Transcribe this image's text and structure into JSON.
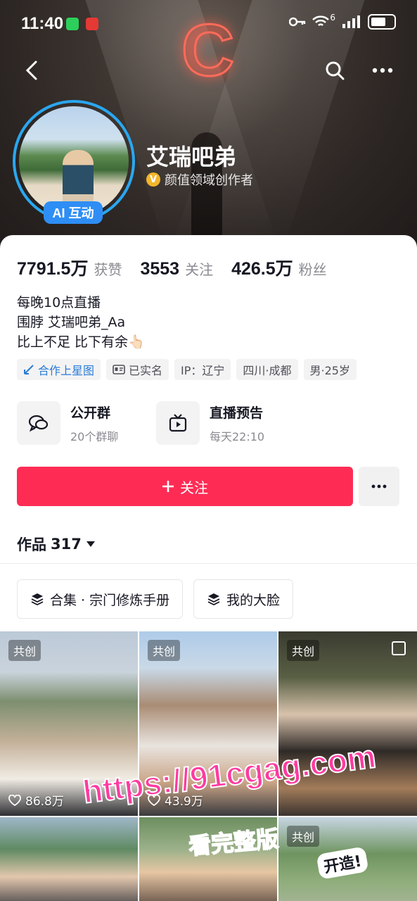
{
  "status_bar": {
    "time": "11:40",
    "network": "6"
  },
  "profile": {
    "nickname": "艾瑞吧弟",
    "verification": "颜值领域创作者",
    "ai_badge": "AI 互动",
    "neon_sign": "C"
  },
  "stats": [
    {
      "value": "7791.5万",
      "label": "获赞"
    },
    {
      "value": "3553",
      "label": "关注"
    },
    {
      "value": "426.5万",
      "label": "粉丝"
    }
  ],
  "bio": [
    "每晚10点直播",
    "围脖 艾瑞吧弟_Aa",
    "比上不足 比下有余👆🏻"
  ],
  "tags": [
    {
      "label": "合作上星图",
      "icon": "star-chart-icon"
    },
    {
      "label": "已实名",
      "icon": "id-card-icon"
    },
    {
      "label": "IP：辽宁"
    },
    {
      "label": "四川·成都"
    },
    {
      "label": "男·25岁"
    }
  ],
  "quick_actions": [
    {
      "title": "公开群",
      "subtitle": "20个群聊",
      "icon": "chat-bubbles-icon"
    },
    {
      "title": "直播预告",
      "subtitle": "每天22:10",
      "icon": "tv-icon"
    }
  ],
  "follow_button": "关注",
  "works": {
    "label": "作品",
    "count": "317"
  },
  "collections": [
    {
      "label": "合集 · 宗门修炼手册",
      "icon": "stack-icon"
    },
    {
      "label": "我的大脸",
      "icon": "stack-icon"
    }
  ],
  "videos": [
    {
      "badge": "共创",
      "likes": "86.8万"
    },
    {
      "badge": "共创",
      "likes": "43.9万"
    },
    {
      "badge": "共创",
      "likes": ""
    },
    {
      "badge": "",
      "likes": ""
    },
    {
      "badge": "",
      "likes": ""
    },
    {
      "badge": "共创",
      "likes": ""
    }
  ],
  "watermark": {
    "url": "https://91cgag.com",
    "text": "看完整版",
    "sticker": "开造!"
  },
  "colors": {
    "follow": "#fe2c55",
    "avatar_ring": "#2aa7f0",
    "ai_badge": "#2e8ef5",
    "watermark": "#ff3aa0"
  }
}
